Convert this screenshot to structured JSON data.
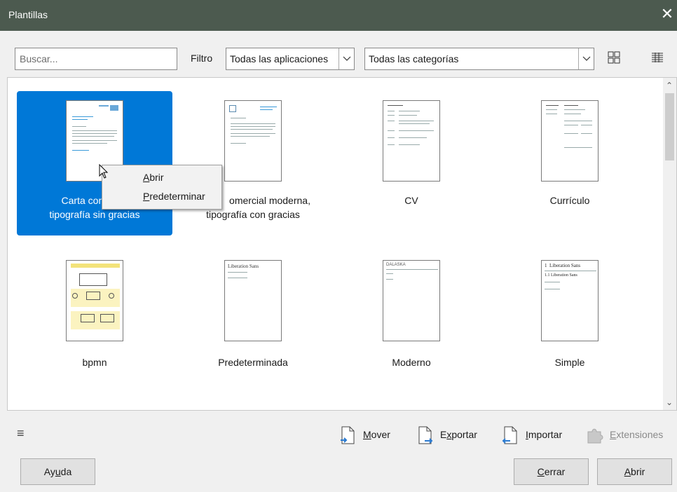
{
  "window": {
    "title": "Plantillas",
    "close_icon": "close-icon"
  },
  "toolbar": {
    "search_placeholder": "Buscar...",
    "filter_label": "Filtro",
    "apps_selected": "Todas las aplicaciones",
    "categories_selected": "Todas las categorías",
    "thumbnail_view_icon": "grid-view-icon",
    "list_view_icon": "list-view-icon"
  },
  "templates": [
    {
      "label": "Carta comercial moderna, tipografía sin gracias",
      "label_visible_line1": "Carta comercia",
      "label_visible_line2": "tipografía sin gracias",
      "selected": true
    },
    {
      "label_line1": "omercial moderna,",
      "label_line2": "tipografía con gracias"
    },
    {
      "label": "CV"
    },
    {
      "label": "Currículo"
    },
    {
      "label": "bpmn"
    },
    {
      "label": "Predeterminada"
    },
    {
      "label": "Moderno"
    },
    {
      "label": "Simple"
    }
  ],
  "context_menu": {
    "items": [
      {
        "label": "Abrir",
        "mnemonic": "A",
        "rest": "brir"
      },
      {
        "label": "Predeterminar",
        "mnemonic": "P",
        "rest": "redeterminar"
      }
    ]
  },
  "thumb_text": {
    "liberation_sans": "Liberation Sans",
    "simple_h1_num": "1",
    "simple_h1": "Liberation Sans",
    "simple_h2_num": "1.1",
    "simple_h2": "Liberation Sans",
    "moderno_head": "DALASKA"
  },
  "actions": {
    "move": {
      "mnemonic": "M",
      "rest": "over"
    },
    "export": {
      "first": "E",
      "mnemonic": "x",
      "rest": "portar"
    },
    "import": {
      "mnemonic": "I",
      "rest": "mportar"
    },
    "extensions": {
      "mnemonic": "E",
      "rest": "xtensiones"
    }
  },
  "buttons": {
    "help": {
      "pre": "Ay",
      "mnemonic": "u",
      "rest": "da"
    },
    "close": {
      "mnemonic": "C",
      "rest": "errar"
    },
    "open": {
      "mnemonic": "A",
      "rest": "brir"
    }
  },
  "colors": {
    "titlebar": "#4c5a4f",
    "selection": "#0078d7"
  }
}
